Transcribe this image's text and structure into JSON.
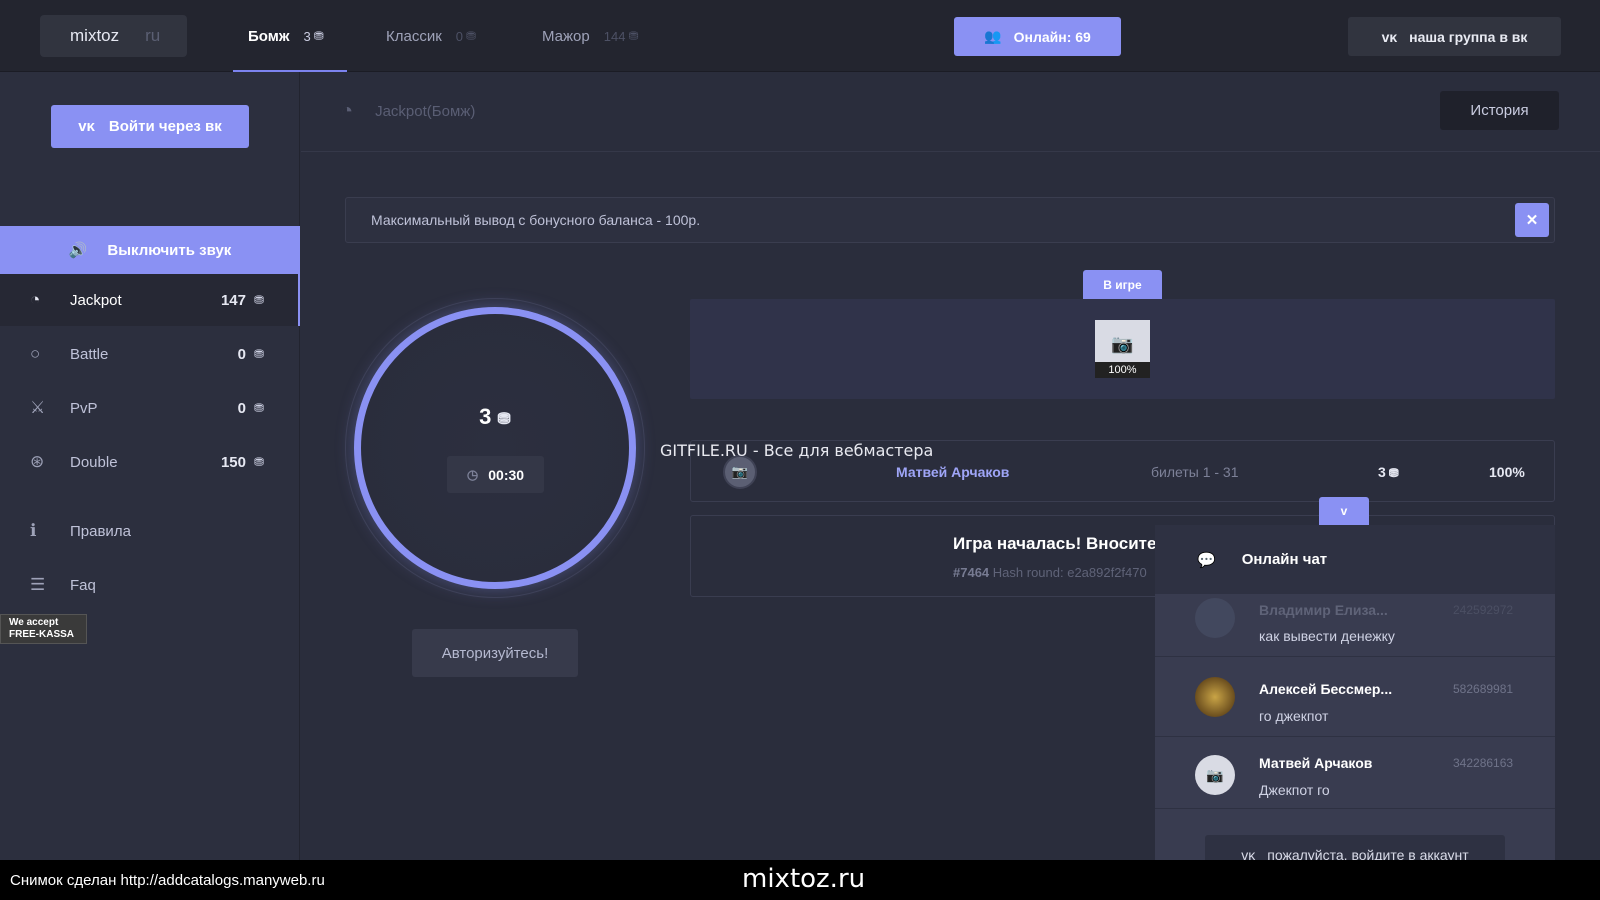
{
  "header": {
    "logo_main": "mixtoz",
    "logo_suffix": "ru",
    "rooms": [
      {
        "name": "Бомж",
        "count": "3"
      },
      {
        "name": "Классик",
        "count": "0"
      },
      {
        "name": "Мажор",
        "count": "144"
      }
    ],
    "online_label": "Онлайн: 69",
    "vk_group_label": "наша группа в вк"
  },
  "sidebar": {
    "login_label": "Войти через вк",
    "sound_label": "Выключить звук",
    "items": [
      {
        "label": "Jackpot",
        "value": "147",
        "icon": "jackpot-icon"
      },
      {
        "label": "Battle",
        "value": "0",
        "icon": "circle-icon"
      },
      {
        "label": "PvP",
        "value": "0",
        "icon": "crossed-swords-icon"
      },
      {
        "label": "Double",
        "value": "150",
        "icon": "wheel-icon"
      },
      {
        "label": "Правила",
        "icon": "info-icon"
      },
      {
        "label": "Faq",
        "icon": "list-icon"
      }
    ],
    "payment_badge_line1": "We accept",
    "payment_badge_line2": "FREE-KASSA"
  },
  "main": {
    "title": "Jackpot(Бомж)",
    "history_label": "История",
    "notice": "Максимальный вывод с бонусного баланса - 100р.",
    "bank": "3",
    "timer": "00:30",
    "auth_label": "Авторизуйтесь!",
    "ingame_label": "В игре",
    "player_percent": "100%",
    "watermark": "GITFILE.RU - Все для вебмастера",
    "bet": {
      "name": "Матвей Арчаков",
      "tickets": "билеты 1 - 31",
      "amount": "3",
      "percent": "100%"
    },
    "chat_toggle": "v",
    "game_title": "Игра началась! Вносите",
    "round_id": "#7464",
    "hash_text": "Hash round: e2a892f2f470"
  },
  "chat": {
    "title": "Онлайн чат",
    "messages": [
      {
        "name": "Владимир Елиза...",
        "id": "242592972",
        "text": "как вывести денежку"
      },
      {
        "name": "Алексей Бессмер...",
        "id": "582689981",
        "text": "го джекпот"
      },
      {
        "name": "Матвей Арчаков",
        "id": "342286163",
        "text": "Джекпот го"
      }
    ],
    "login_prompt": "пожалуйста, войдите в аккаунт"
  },
  "footer": {
    "left_text": "Снимок сделан http://addcatalogs.manyweb.ru",
    "center_text": "mixtoz.ru"
  },
  "colors": {
    "accent": "#8a91f3",
    "background": "#2a2d3c",
    "sidebar": "#2c2f3e",
    "header": "#23252f"
  }
}
